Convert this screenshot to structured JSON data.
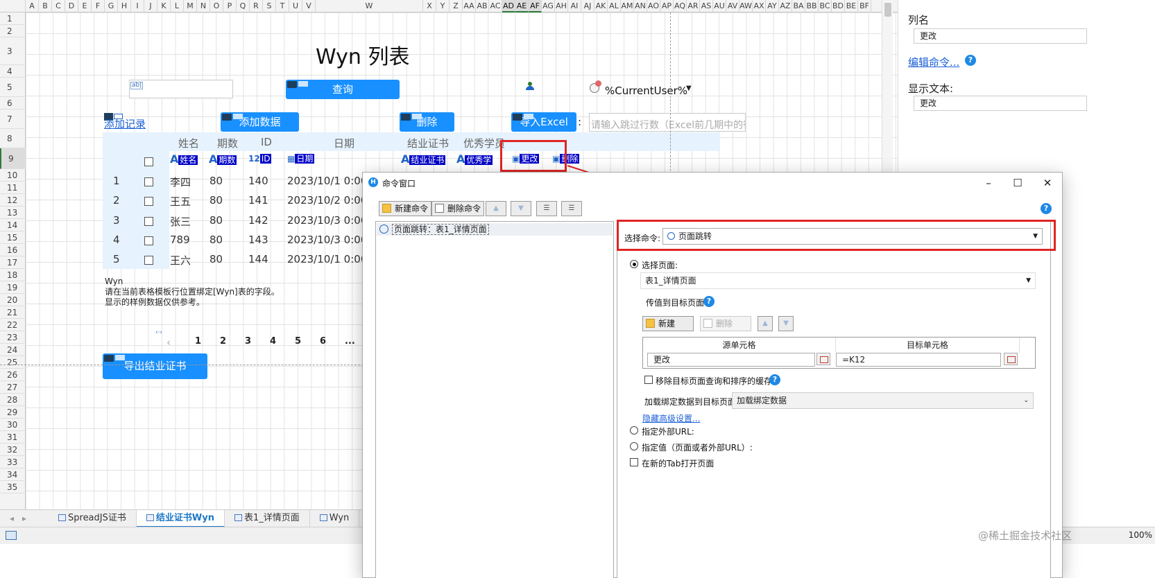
{
  "sheet": {
    "col_headers": [
      "A",
      "B",
      "C",
      "D",
      "E",
      "F",
      "G",
      "H",
      "I",
      "J",
      "K",
      "L",
      "M",
      "N",
      "O",
      "P",
      "Q",
      "R",
      "S",
      "T",
      "U",
      "V",
      "W",
      "X",
      "Y",
      "Z",
      "AA",
      "AB",
      "AC",
      "AD",
      "AE",
      "AF",
      "AG",
      "AH",
      "AI",
      "AJ",
      "AK",
      "AL",
      "AM",
      "AN",
      "AO",
      "AP",
      "AQ",
      "AR",
      "AS",
      "AU",
      "AV",
      "AW",
      "AX",
      "AY",
      "AZ",
      "BA",
      "BB",
      "BC",
      "BD",
      "BE",
      "BF"
    ],
    "row_headers": [
      "1",
      "2",
      "3",
      "4",
      "5",
      "6",
      "7",
      "8",
      "9",
      "10",
      "11",
      "12",
      "13",
      "14",
      "15",
      "16",
      "17",
      "18",
      "19",
      "20",
      "21",
      "22",
      "23",
      "24",
      "25",
      "26",
      "27",
      "28",
      "29",
      "30",
      "31",
      "32",
      "33",
      "34",
      "35"
    ],
    "title": "Wyn 列表",
    "query_button": "查询",
    "current_user": "%CurrentUser%",
    "add_record_link": "添加记录",
    "add_data_button": "添加数据",
    "delete_button": "删除",
    "import_excel_button": "导入Excel",
    "colon": ":",
    "skip_rows_placeholder": "请输入跳过行数（Excel前几期中的行",
    "column_headers": [
      "姓名",
      "期数",
      "ID",
      "日期",
      "结业证书",
      "优秀学员"
    ],
    "binding_tags": [
      "姓名",
      "期数",
      "ID",
      "日期",
      "结业证书",
      "优秀学",
      "更改",
      "删除"
    ],
    "rows": [
      {
        "no": "1",
        "name": "李四",
        "period": "80",
        "id": "140",
        "date": "2023/10/1 0:00:0"
      },
      {
        "no": "2",
        "name": "王五",
        "period": "80",
        "id": "141",
        "date": "2023/10/2 0:00:0"
      },
      {
        "no": "3",
        "name": "张三",
        "period": "80",
        "id": "142",
        "date": "2023/10/3 0:00:0"
      },
      {
        "no": "4",
        "name": "789",
        "period": "80",
        "id": "143",
        "date": "2023/10/3 0:00:0"
      },
      {
        "no": "5",
        "name": "王六",
        "period": "80",
        "id": "144",
        "date": "2023/10/1 0:00:0"
      }
    ],
    "note_title": "Wyn",
    "note_line1": "请在当前表格模板行位置绑定[Wyn]表的字段。",
    "note_line2": "显示的样例数据仅供参考。",
    "pagination": [
      "1",
      "2",
      "3",
      "4",
      "5",
      "6",
      "..."
    ],
    "export_button": "导出结业证书"
  },
  "tabs": [
    {
      "label": "SpreadJS证书",
      "active": false
    },
    {
      "label": "结业证书Wyn",
      "active": true
    },
    {
      "label": "表1_详情页面",
      "active": false
    },
    {
      "label": "Wyn",
      "active": false
    }
  ],
  "status": {
    "zoom": "100%"
  },
  "right_panel": {
    "column_name_label": "列名",
    "column_name_value": "更改",
    "edit_command_link": "编辑命令...",
    "display_text_label": "显示文本:",
    "display_text_value": "更改"
  },
  "dialog": {
    "title": "命令窗口",
    "new_command": "新建命令",
    "delete_command": "删除命令",
    "command_item": "页面跳转：表1_详情页面",
    "select_command_label": "选择命令:",
    "select_command_value": "页面跳转",
    "select_page_label": "选择页面:",
    "select_page_value": "表1_详情页面",
    "pass_value_label": "传值到目标页面",
    "new_button": "新建",
    "delete_button": "删除",
    "source_cell_header": "源单元格",
    "target_cell_header": "目标单元格",
    "source_cell_value": "更改",
    "target_cell_value": "=K12",
    "remove_cache_label": "移除目标页面查询和排序的缓存",
    "load_binding_label": "加载绑定数据到目标页面",
    "load_binding_value": "加载绑定数据",
    "hide_advanced_link": "隐藏高级设置...",
    "external_url_label": "指定外部URL:",
    "specified_value_label": "指定值（页面或者外部URL）:",
    "new_tab_label": "在新的Tab打开页面"
  },
  "watermark": "@稀土掘金技术社区",
  "colors": {
    "accent": "#1890ff",
    "highlight": "#e02424",
    "tag": "#0000c8"
  }
}
